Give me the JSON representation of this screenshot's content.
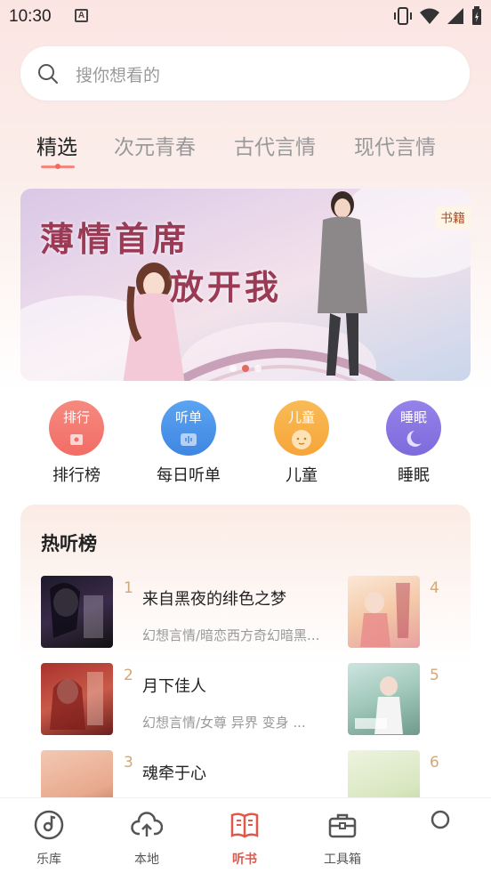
{
  "status_bar": {
    "time": "10:30",
    "notification_glyph": "A"
  },
  "search": {
    "placeholder": "搜你想看的"
  },
  "tabs": [
    {
      "label": "精选",
      "active": true
    },
    {
      "label": "次元青春",
      "active": false
    },
    {
      "label": "古代言情",
      "active": false
    },
    {
      "label": "现代言情",
      "active": false
    }
  ],
  "banner": {
    "title_line1": "薄情首席",
    "title_line2": "放开我",
    "tag": "书籍",
    "page_count": 3,
    "active_page": 1
  },
  "quick_links": [
    {
      "badge": "排行",
      "label": "排行榜",
      "icon": "ranking-icon",
      "color": "#f26d66"
    },
    {
      "badge": "听单",
      "label": "每日听单",
      "icon": "playlist-icon",
      "color": "#4a90e8"
    },
    {
      "badge": "儿童",
      "label": "儿童",
      "icon": "child-icon",
      "color": "#f6a53a"
    },
    {
      "badge": "睡眠",
      "label": "睡眠",
      "icon": "moon-icon",
      "color": "#7d6bdc"
    }
  ],
  "hot_list": {
    "title": "热听榜",
    "items": [
      {
        "rank": "1",
        "name": "来自黑夜的绯色之梦",
        "desc": "幻想言情/暗恋西方奇幻暗黑..."
      },
      {
        "rank": "2",
        "name": "月下佳人",
        "desc": "幻想言情/女尊 异界 变身 ..."
      },
      {
        "rank": "3",
        "name": "魂牵于心",
        "desc": ""
      }
    ],
    "side_items": [
      {
        "rank": "4"
      },
      {
        "rank": "5"
      },
      {
        "rank": "6"
      }
    ]
  },
  "bottom_nav": [
    {
      "label": "乐库",
      "icon": "music-disc-icon",
      "active": false
    },
    {
      "label": "本地",
      "icon": "cloud-upload-icon",
      "active": false
    },
    {
      "label": "听书",
      "icon": "book-icon",
      "active": true
    },
    {
      "label": "工具箱",
      "icon": "toolbox-icon",
      "active": false
    }
  ]
}
